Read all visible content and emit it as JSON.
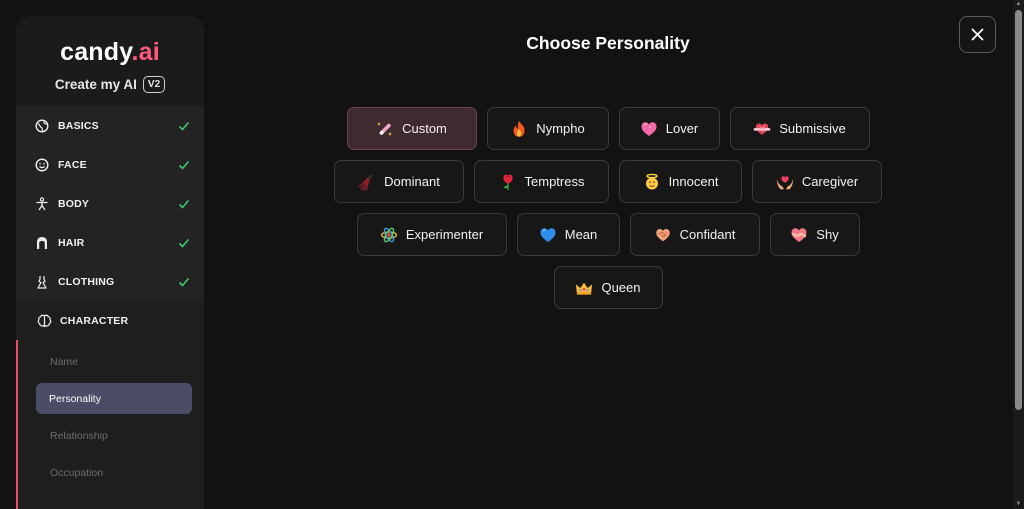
{
  "brand": {
    "logo_main": "candy",
    "logo_accent": ".ai",
    "subtitle": "Create my AI",
    "version": "V2"
  },
  "steps": [
    {
      "label": "BASICS",
      "icon": "globe-icon",
      "done": true
    },
    {
      "label": "FACE",
      "icon": "smiley-icon",
      "done": true
    },
    {
      "label": "BODY",
      "icon": "person-icon",
      "done": true
    },
    {
      "label": "HAIR",
      "icon": "hair-icon",
      "done": true
    },
    {
      "label": "CLOTHING",
      "icon": "dress-icon",
      "done": true
    }
  ],
  "active_step": {
    "label": "CHARACTER",
    "icon": "brain-icon",
    "substeps": [
      {
        "label": "Name",
        "selected": false
      },
      {
        "label": "Personality",
        "selected": true
      },
      {
        "label": "Relationship",
        "selected": false
      },
      {
        "label": "Occupation",
        "selected": false
      }
    ]
  },
  "main": {
    "title": "Choose Personality",
    "close_icon": "close-icon"
  },
  "options": [
    [
      {
        "label": "Custom",
        "icon": "magic-wand-icon",
        "selected": true
      },
      {
        "label": "Nympho",
        "icon": "fire-icon"
      },
      {
        "label": "Lover",
        "icon": "heart-icon"
      },
      {
        "label": "Submissive",
        "icon": "heart-ribbon-icon"
      }
    ],
    [
      {
        "label": "Dominant",
        "icon": "whip-icon"
      },
      {
        "label": "Temptress",
        "icon": "rose-icon"
      },
      {
        "label": "Innocent",
        "icon": "angel-icon"
      },
      {
        "label": "Caregiver",
        "icon": "hands-heart-icon"
      }
    ],
    [
      {
        "label": "Experimenter",
        "icon": "atom-icon"
      },
      {
        "label": "Mean",
        "icon": "blue-heart-icon"
      },
      {
        "label": "Confidant",
        "icon": "handshake-heart-icon"
      },
      {
        "label": "Shy",
        "icon": "blushing-heart-icon"
      }
    ],
    [
      {
        "label": "Queen",
        "icon": "crown-icon"
      }
    ]
  ],
  "colors": {
    "accent": "#ff5c7c",
    "selected_bg": "#3f2a30",
    "sub_selected_bg": "#4b4d66",
    "check": "#3fc96b"
  }
}
